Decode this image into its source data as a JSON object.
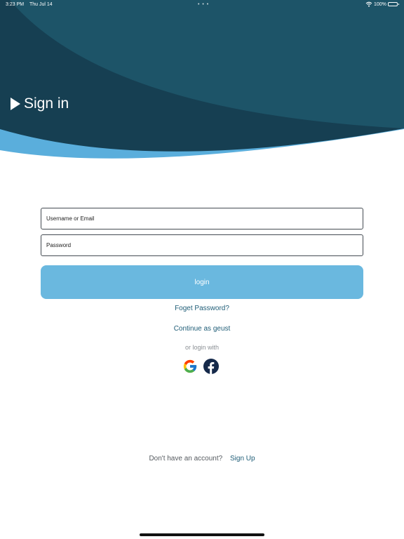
{
  "status_bar": {
    "time": "3:23 PM",
    "date": "Thu Jul 14",
    "dots": "• • •",
    "battery": "100%",
    "wifi_icon": "wifi-icon",
    "battery_icon": "battery-icon"
  },
  "header": {
    "title": "Sign in",
    "icon": "play-icon",
    "colors": {
      "dark": "#163f52",
      "mid": "#1d5468",
      "accent": "#5aaedc"
    }
  },
  "form": {
    "username_placeholder": "Username or Email",
    "username_value": "",
    "password_placeholder": "Password",
    "password_value": "",
    "login_label": "login",
    "login_color": "#6ab8df"
  },
  "links": {
    "forgot_password": "Foget Password?",
    "continue_guest": "Continue as geust",
    "or_login_with": "or login with",
    "link_color": "#1f5d77"
  },
  "social": {
    "google_icon": "google-icon",
    "facebook_icon": "facebook-icon",
    "facebook_color": "#15294a"
  },
  "footer": {
    "signup_prompt": "Don't have an account?",
    "signup_label": "Sign Up"
  }
}
